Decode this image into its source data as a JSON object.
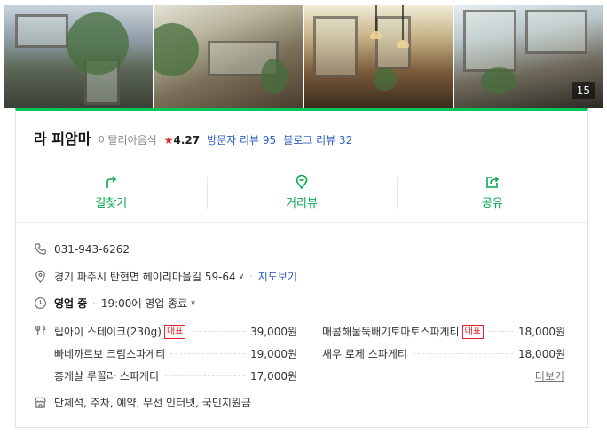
{
  "gallery": {
    "photo_count": "15",
    "photos": [
      "exterior-photo",
      "interior-photo",
      "dining-room-photo",
      "terrace-photo"
    ]
  },
  "place": {
    "name": "라 피암마",
    "category": "이탈리아음식",
    "rating_star": "★",
    "rating": "4.27",
    "visitor_reviews": "방문자 리뷰 95",
    "blog_reviews": "블로그 리뷰 32"
  },
  "actions": {
    "directions": "길찾기",
    "street_view": "거리뷰",
    "share": "공유"
  },
  "info": {
    "phone": "031-943-6262",
    "address": "경기 파주시 탄현면 헤이리마을길 59-64",
    "map_link": "지도보기",
    "status": "영업 중",
    "hours": "19:00에 영업 종료",
    "amenities": "단체석, 주차, 예약, 무선 인터넷, 국민지원금"
  },
  "menu": {
    "rep_tag": "대표",
    "more": "더보기",
    "items": [
      {
        "name": "립아이 스테이크(230g)",
        "price": "39,000원",
        "rep": true
      },
      {
        "name": "매콤해물뚝배기토마토스파게티",
        "price": "18,000원",
        "rep": true
      },
      {
        "name": "빠네까르보 크림스파게티",
        "price": "19,000원",
        "rep": false
      },
      {
        "name": "새우 로제 스파게티",
        "price": "18,000원",
        "rep": false
      },
      {
        "name": "홍게살 루꼴라 스파게티",
        "price": "17,000원",
        "rep": false
      }
    ]
  },
  "colors": {
    "accent_green": "#03c75a",
    "link_blue": "#2f5fc2",
    "star_red": "#e4242b"
  }
}
